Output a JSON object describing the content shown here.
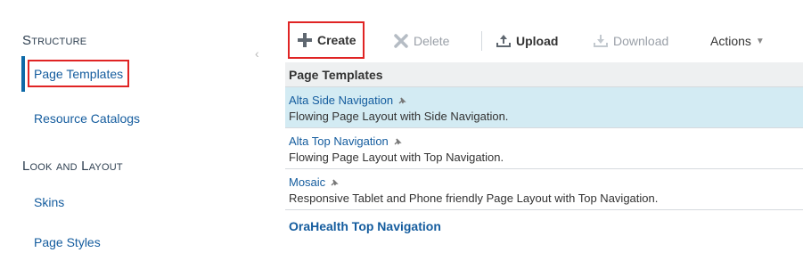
{
  "sidebar": {
    "structure_title": "Structure",
    "items_structure": [
      {
        "label": "Page Templates"
      },
      {
        "label": "Resource Catalogs"
      }
    ],
    "look_title": "Look and Layout",
    "items_look": [
      {
        "label": "Skins"
      },
      {
        "label": "Page Styles"
      }
    ],
    "collapse_glyph": "‹"
  },
  "toolbar": {
    "create_label": "Create",
    "delete_label": "Delete",
    "upload_label": "Upload",
    "download_label": "Download",
    "actions_label": "Actions",
    "actions_caret": "▼"
  },
  "table": {
    "header": "Page Templates",
    "rows": [
      {
        "name": "Alta Side Navigation",
        "desc": "Flowing Page Layout with Side Navigation."
      },
      {
        "name": "Alta Top Navigation",
        "desc": "Flowing Page Layout with Top Navigation."
      },
      {
        "name": "Mosaic",
        "desc": "Responsive Tablet and Phone friendly Page Layout with Top Navigation."
      }
    ],
    "last_row": "OraHealth Top Navigation"
  },
  "colors": {
    "accent": "#0e6aa8",
    "link": "#145c9e",
    "highlight_border": "#e02424",
    "selected_row": "#d3ebf3"
  }
}
